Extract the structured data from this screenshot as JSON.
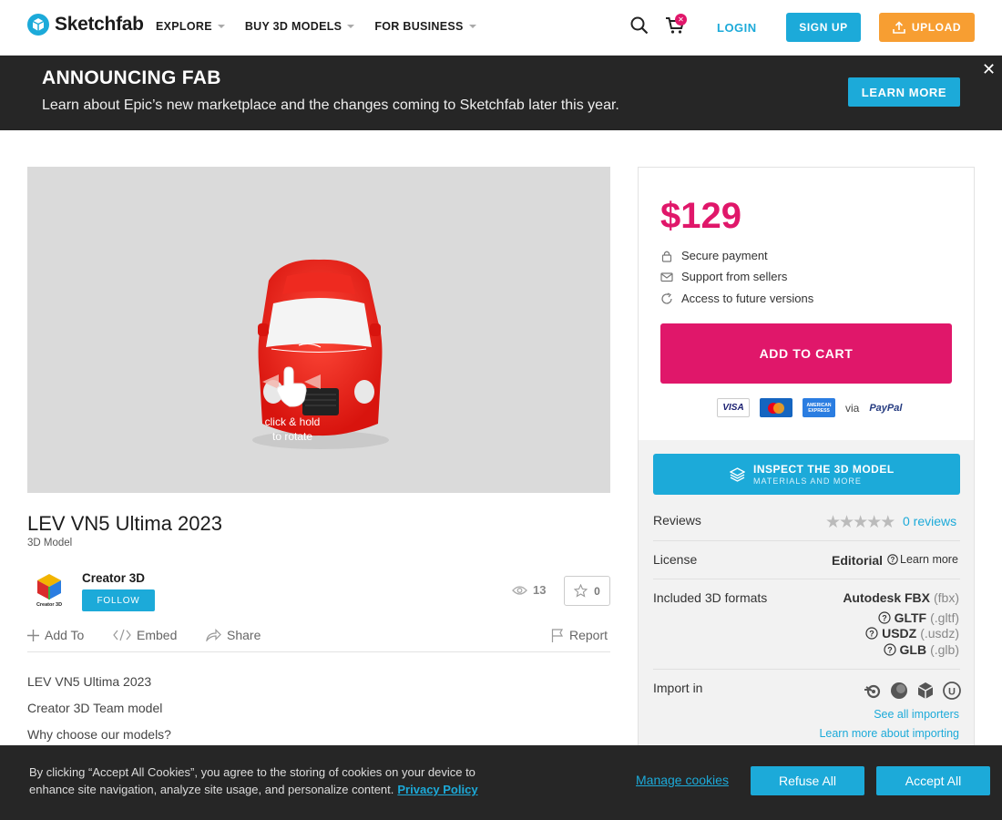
{
  "header": {
    "logo_text": "Sketchfab",
    "nav": [
      "EXPLORE",
      "BUY 3D MODELS",
      "FOR BUSINESS"
    ],
    "cart_count": "",
    "login_label": "LOGIN",
    "signup_label": "SIGN UP",
    "upload_label": "UPLOAD"
  },
  "banner": {
    "title": "ANNOUNCING FAB",
    "text": "Learn about Epic’s new marketplace and the changes coming to Sketchfab later this year.",
    "button_label": "LEARN MORE",
    "close_glyph": "✕"
  },
  "viewer": {
    "hint_line1": "click & hold",
    "hint_line2": "to rotate"
  },
  "model": {
    "title": "LEV VN5 Ultima 2023",
    "type": "3D Model",
    "creator_name": "Creator 3D",
    "follow_label": "FOLLOW",
    "views": "13",
    "likes": "0"
  },
  "actions": {
    "add_to": "Add To",
    "embed": "Embed",
    "share": "Share",
    "report": "Report"
  },
  "description": [
    "LEV VN5 Ultima 2023",
    "Creator 3D Team model",
    "Why choose our models?"
  ],
  "purchase": {
    "price": "$129",
    "perks": [
      "Secure payment",
      "Support from sellers",
      "Access to future versions"
    ],
    "add_to_cart_label": "ADD TO CART",
    "via": "via",
    "paypal": "PayPal",
    "visa": "VISA",
    "amex": "AMERICAN EXPRESS"
  },
  "info": {
    "inspect_title": "INSPECT THE 3D MODEL",
    "inspect_sub": "MATERIALS AND MORE",
    "reviews_label": "Reviews",
    "reviews_count": "0 reviews",
    "rating": 0,
    "license_label": "License",
    "license_value": "Editorial",
    "license_more": "Learn more",
    "formats_label": "Included 3D formats",
    "formats": [
      {
        "name": "Autodesk FBX",
        "ext": "(fbx)"
      },
      {
        "name": "GLTF",
        "ext": "(.gltf)"
      },
      {
        "name": "USDZ",
        "ext": "(.usdz)"
      },
      {
        "name": "GLB",
        "ext": "(.glb)"
      }
    ],
    "import_label": "Import in",
    "see_importers": "See all importers",
    "learn_importing": "Learn more about importing"
  },
  "cookie": {
    "text": "By clicking “Accept All Cookies”, you agree to the storing of cookies on your device to enhance site navigation, analyze site usage, and personalize content.",
    "privacy": "Privacy Policy",
    "manage": "Manage cookies",
    "refuse": "Refuse All",
    "accept": "Accept All"
  },
  "colors": {
    "accent": "#1caad9",
    "price": "#e0176a",
    "upload": "#f79e32",
    "dark": "#262626"
  }
}
